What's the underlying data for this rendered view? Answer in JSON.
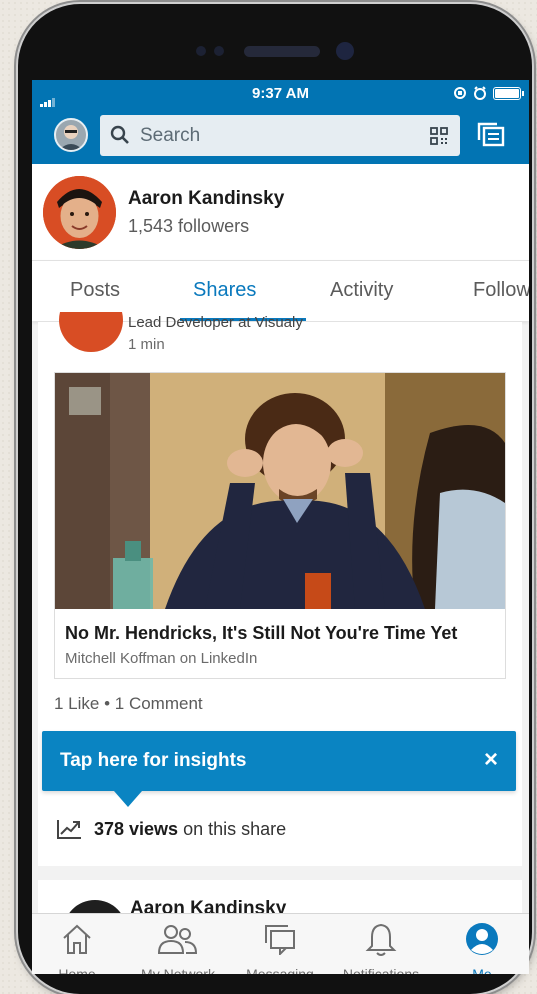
{
  "status_bar": {
    "time": "9:37 AM"
  },
  "search": {
    "placeholder": "Search"
  },
  "profile": {
    "name": "Aaron Kandinsky",
    "followers": "1,543 followers"
  },
  "tabs": [
    {
      "label": "Posts"
    },
    {
      "label": "Shares"
    },
    {
      "label": "Activity"
    },
    {
      "label": "Follow"
    }
  ],
  "post": {
    "headline": "Lead Developer at Visualy",
    "time_ago": "1 min",
    "article_title": "No Mr. Hendricks, It's Still Not You're Time Yet",
    "article_source": "Mitchell Koffman on LinkedIn",
    "social_counts": "1 Like • 1 Comment",
    "insights_banner": "Tap here for insights",
    "insights_close": "×",
    "views_count": "378 views",
    "views_suffix": "on this share"
  },
  "next_post": {
    "author": "Aaron Kandinsky"
  },
  "nav": [
    {
      "label": "Home",
      "icon": "home-icon"
    },
    {
      "label": "My Network",
      "icon": "network-icon"
    },
    {
      "label": "Messaging",
      "icon": "messaging-icon"
    },
    {
      "label": "Notifications",
      "icon": "bell-icon"
    },
    {
      "label": "Me",
      "icon": "me-icon"
    }
  ],
  "colors": {
    "brand": "#0274b3",
    "accent": "#0a79bd",
    "banner": "#0a84c2"
  }
}
